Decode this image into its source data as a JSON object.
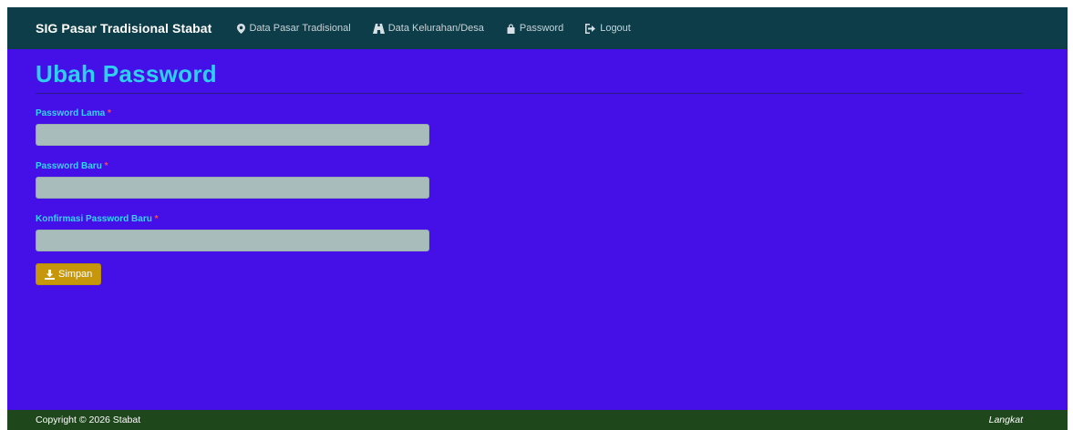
{
  "navbar": {
    "brand": "SIG Pasar Tradisional Stabat",
    "items": [
      {
        "label": "Data Pasar Tradisional",
        "icon": "map-marker-icon"
      },
      {
        "label": "Data Kelurahan/Desa",
        "icon": "road-icon"
      },
      {
        "label": "Password",
        "icon": "lock-icon"
      },
      {
        "label": "Logout",
        "icon": "logout-icon"
      }
    ]
  },
  "page": {
    "title": "Ubah Password"
  },
  "form": {
    "fields": [
      {
        "label": "Password Lama",
        "required_mark": "*",
        "value": ""
      },
      {
        "label": "Password Baru",
        "required_mark": "*",
        "value": ""
      },
      {
        "label": "Konfirmasi Password Baru",
        "required_mark": "*",
        "value": ""
      }
    ],
    "submit": {
      "label": "Simpan",
      "icon": "download-icon"
    }
  },
  "footer": {
    "copyright": "Copyright © 2026 Stabat",
    "place": "Langkat"
  },
  "colors": {
    "page_bg": "#4510e8",
    "navbar_bg": "#0c3d49",
    "title": "#2ed0f2",
    "input_bg": "#a8bcbc",
    "button_bg": "#c7970b",
    "footer_bg": "#1f471c"
  }
}
